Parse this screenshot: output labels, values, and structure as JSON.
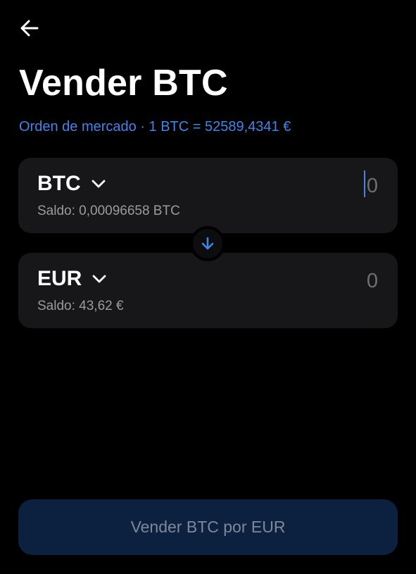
{
  "header": {
    "back_icon": "arrow-left-icon",
    "title": "Vender BTC",
    "rate_text": "Orden de mercado · 1 BTC = 52589,4341 €"
  },
  "from": {
    "currency": "BTC",
    "chevron_icon": "chevron-down-icon",
    "balance": "Saldo: 0,00096658 BTC",
    "amount_placeholder": "0"
  },
  "swap": {
    "icon": "arrow-down-icon"
  },
  "to": {
    "currency": "EUR",
    "chevron_icon": "chevron-down-icon",
    "balance": "Saldo: 43,62 €",
    "amount_placeholder": "0"
  },
  "action": {
    "label": "Vender BTC por EUR"
  },
  "colors": {
    "background": "#000000",
    "card": "#171719",
    "accent": "#3f86ea",
    "button_disabled_bg": "#0c2140",
    "button_disabled_text": "#7d8899"
  }
}
